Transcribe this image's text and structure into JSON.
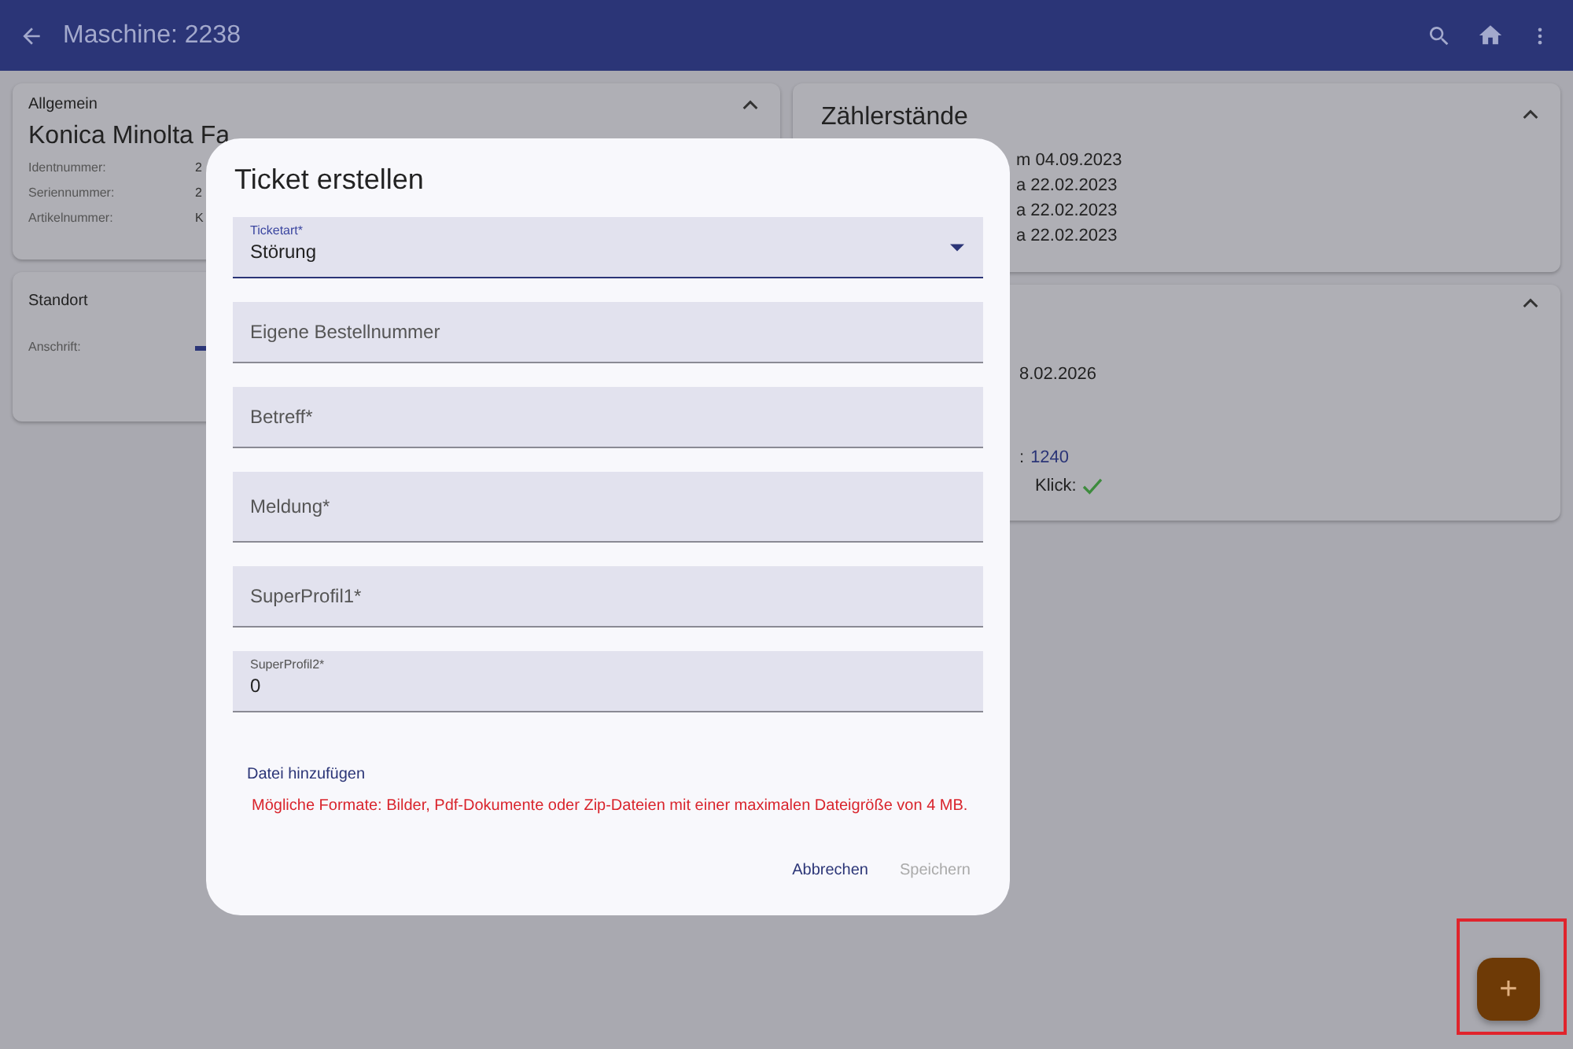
{
  "app_bar": {
    "title": "Maschine: 2238"
  },
  "general_card": {
    "heading": "Allgemein",
    "expanded": true,
    "title": "Konica Minolta Fa",
    "fields": [
      {
        "label": "Identnummer:",
        "value": "2"
      },
      {
        "label": "Seriennummer:",
        "value": "2"
      },
      {
        "label": "Artikelnummer:",
        "value": "K"
      }
    ]
  },
  "location_card": {
    "heading": "Standort",
    "label": "Anschrift:"
  },
  "counter_card": {
    "heading": "Zählerstände",
    "expanded": true,
    "lines": [
      "m 04.09.2023",
      "a 22.02.2023",
      "a 22.02.2023",
      "a 22.02.2023"
    ]
  },
  "second_card": {
    "expanded": true,
    "lines": [
      {
        "kind": "text",
        "text": "8.02.2026"
      },
      {
        "kind": "link",
        "label": ":",
        "value": "1240"
      },
      {
        "kind": "check",
        "label": "Klick:",
        "checked": true
      }
    ]
  },
  "dialog": {
    "title": "Ticket erstellen",
    "fields": [
      {
        "kind": "select",
        "label": "Ticketart*",
        "value": "Störung",
        "focused": true
      },
      {
        "kind": "text",
        "placeholder": "Eigene Bestellnummer"
      },
      {
        "kind": "text",
        "placeholder": "Betreff*"
      },
      {
        "kind": "textarea",
        "placeholder": "Meldung*"
      },
      {
        "kind": "text",
        "placeholder": "SuperProfil1*"
      },
      {
        "kind": "text",
        "label": "SuperProfil2*",
        "value": "0"
      }
    ],
    "attach_link": "Datei hinzufügen",
    "note": "Mögliche Formate: Bilder, Pdf-Dokumente oder Zip-Dateien mit einer maximalen Dateigröße von 4 MB.",
    "buttons": [
      {
        "label": "Abbrechen",
        "disabled": false
      },
      {
        "label": "Speichern",
        "disabled": true
      }
    ]
  },
  "fab": {
    "label": "+",
    "highlighted": true
  }
}
